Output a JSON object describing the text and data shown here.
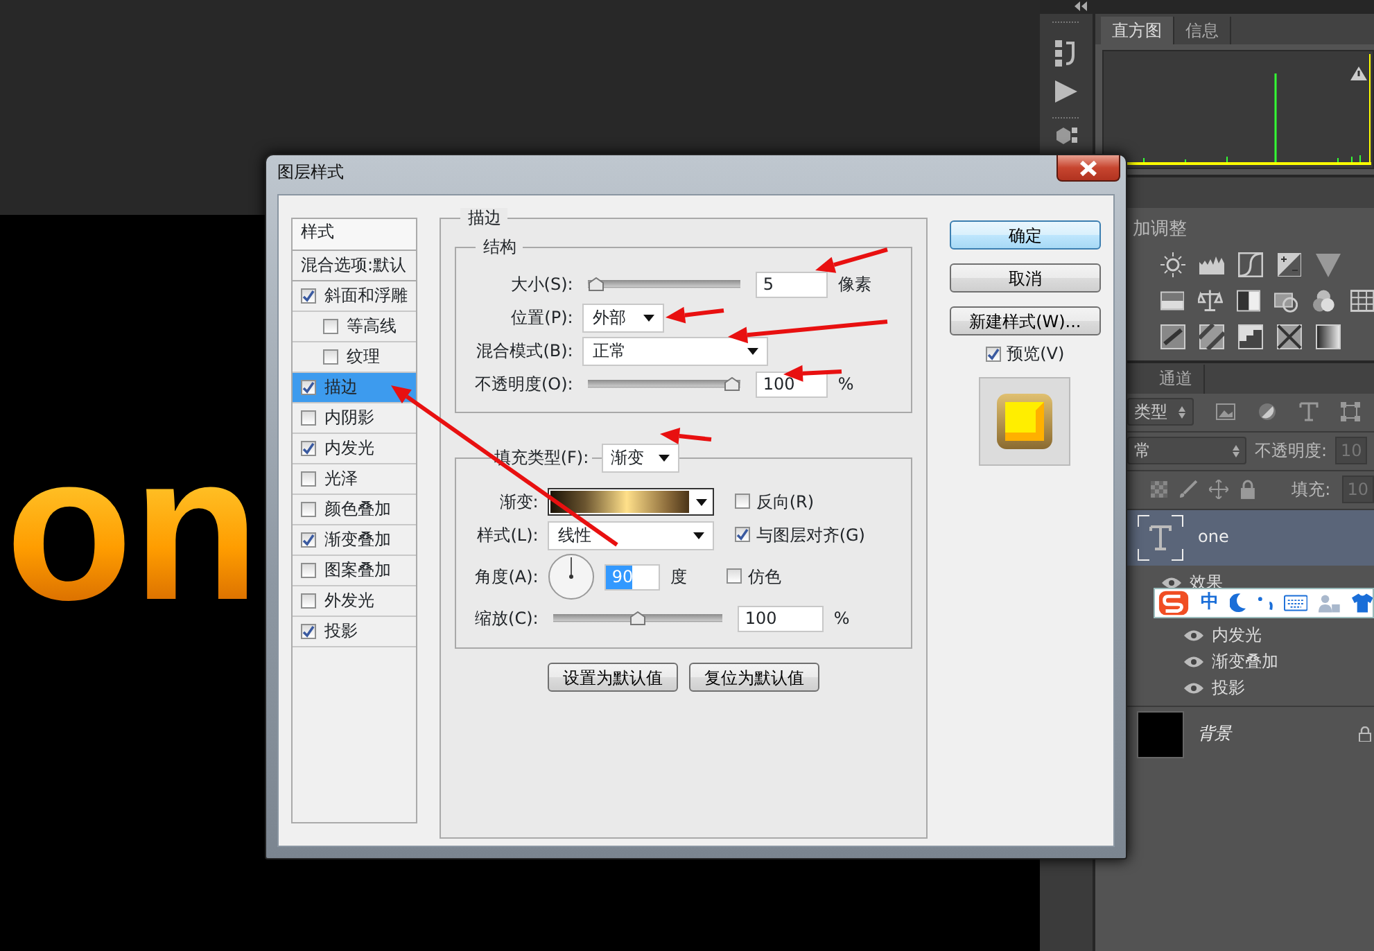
{
  "canvas": {
    "text": "on"
  },
  "histogram_panel": {
    "tabs": [
      {
        "label": "直方图",
        "selected": true
      },
      {
        "label": "信息",
        "selected": false
      }
    ]
  },
  "adjustments_panel": {
    "title": "加调整"
  },
  "layers_panel": {
    "tabs": [
      {
        "label": "通道",
        "selected": false
      }
    ],
    "filter": "类型",
    "blend_mode": "常",
    "opacity_label": "不透明度:",
    "opacity": "10",
    "fill_label": "填充:",
    "fill": "10",
    "layers": [
      {
        "kind": "text",
        "name": "one",
        "selected": true,
        "effects_label": "效果",
        "effects": [
          {
            "name": "内发光"
          },
          {
            "name": "渐变叠加"
          },
          {
            "name": "投影"
          }
        ]
      },
      {
        "kind": "fill",
        "name": "背景",
        "selected": false
      }
    ]
  },
  "ime_toolbar": {
    "label": "中"
  },
  "dialog": {
    "title": "图层样式",
    "styles_header": "样式",
    "blend_options": "混合选项:默认",
    "effects": [
      {
        "label": "斜面和浮雕",
        "checked": true,
        "selected": false,
        "children": [
          {
            "label": "等高线",
            "checked": false,
            "selected": false
          },
          {
            "label": "纹理",
            "checked": false,
            "selected": false
          }
        ]
      },
      {
        "label": "描边",
        "checked": true,
        "selected": true
      },
      {
        "label": "内阴影",
        "checked": false,
        "selected": false
      },
      {
        "label": "内发光",
        "checked": true,
        "selected": false
      },
      {
        "label": "光泽",
        "checked": false,
        "selected": false
      },
      {
        "label": "颜色叠加",
        "checked": false,
        "selected": false
      },
      {
        "label": "渐变叠加",
        "checked": true,
        "selected": false
      },
      {
        "label": "图案叠加",
        "checked": false,
        "selected": false
      },
      {
        "label": "外发光",
        "checked": false,
        "selected": false
      },
      {
        "label": "投影",
        "checked": true,
        "selected": false
      }
    ],
    "stroke": {
      "title": "描边",
      "structure_title": "结构",
      "size": {
        "label": "大小(S):",
        "level": 0.0,
        "value": "5",
        "unit": "像素"
      },
      "position": {
        "label": "位置(P):",
        "value": "外部"
      },
      "blend_mode": {
        "label": "混合模式(B):",
        "value": "正常"
      },
      "opacity": {
        "label": "不透明度(O):",
        "level": 1.0,
        "value": "100",
        "unit": "%"
      },
      "fill_type": {
        "label": "填充类型(F):",
        "value": "渐变"
      },
      "gradient": {
        "label": "渐变:"
      },
      "reverse": {
        "label": "反向(R)",
        "checked": false
      },
      "style": {
        "label": "样式(L):",
        "value": "线性"
      },
      "align": {
        "label": "与图层对齐(G)",
        "checked": true
      },
      "angle": {
        "label": "角度(A):",
        "value": "90",
        "unit": "度"
      },
      "dither": {
        "label": "仿色",
        "checked": false
      },
      "scale": {
        "label": "缩放(C):",
        "level": 0.5,
        "value": "100",
        "unit": "%"
      }
    },
    "bottom_buttons": [
      "设置为默认值",
      "复位为默认值"
    ],
    "side_buttons": [
      {
        "label": "确定",
        "kind": "default"
      },
      {
        "label": "取消",
        "kind": "normal"
      },
      {
        "label": "新建样式(W)...",
        "kind": "normal"
      }
    ],
    "preview": {
      "label": "预览(V)",
      "checked": true
    }
  }
}
